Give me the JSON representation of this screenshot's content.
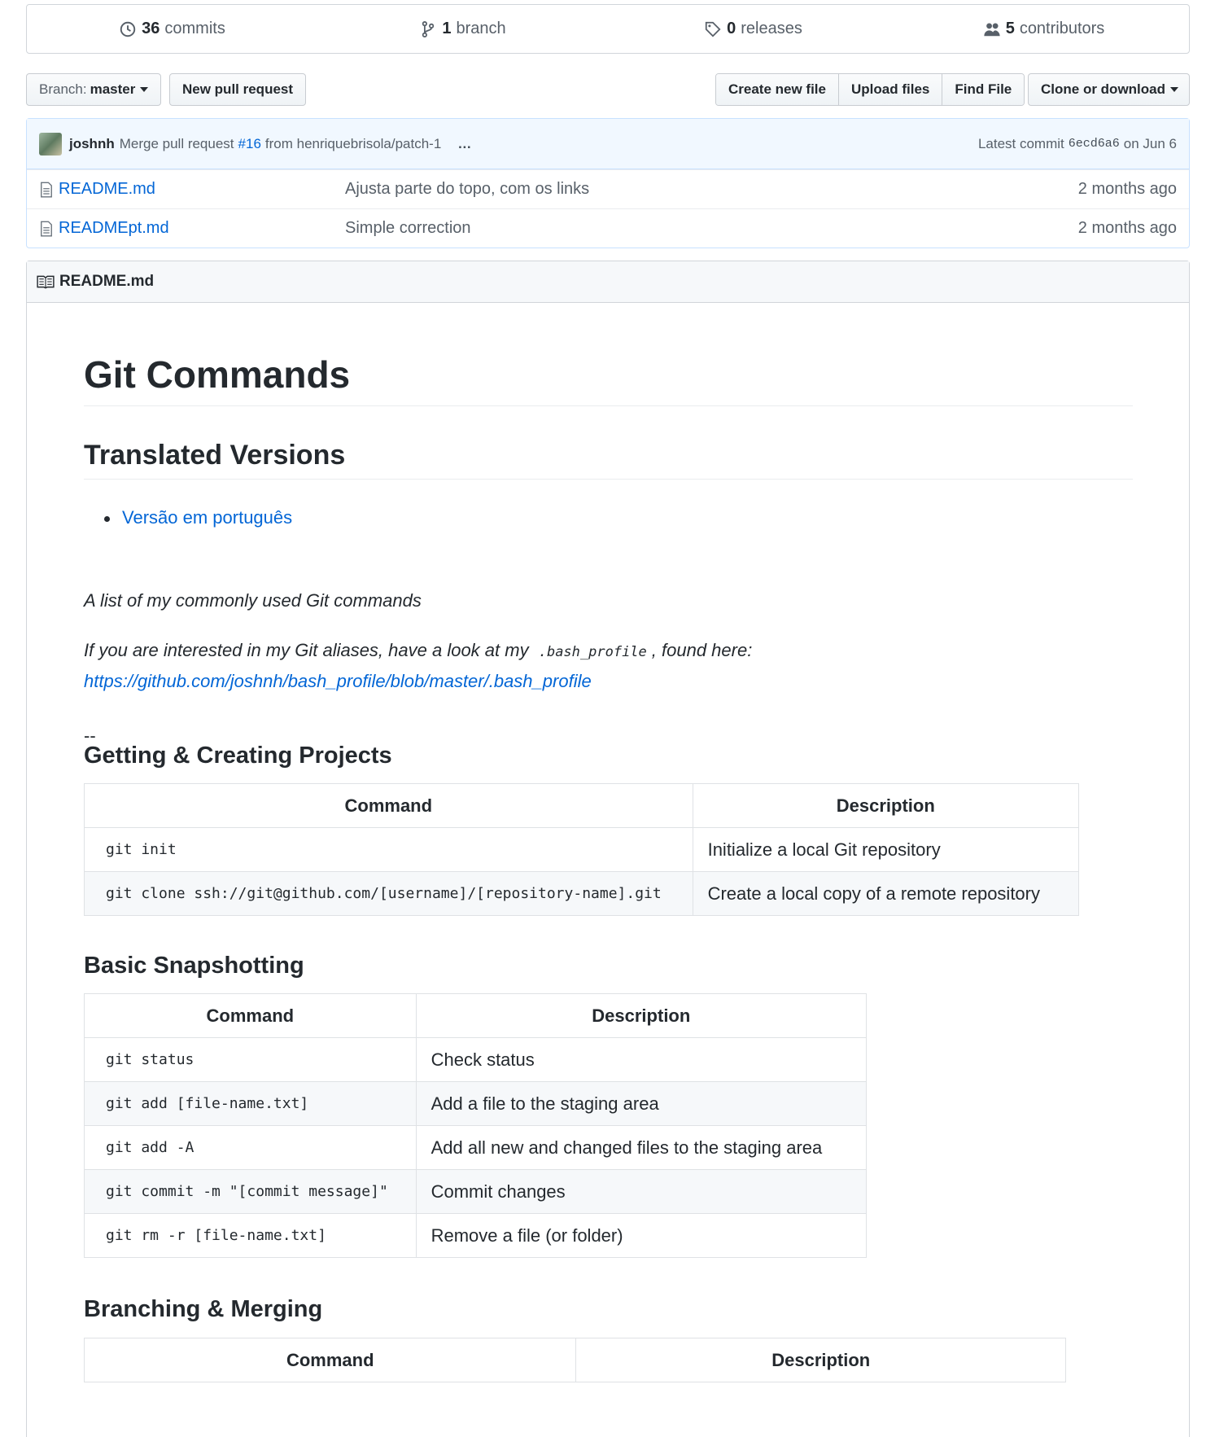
{
  "summary": {
    "commits_count": "36",
    "commits_label": "commits",
    "branch_count": "1",
    "branch_label": "branch",
    "releases_count": "0",
    "releases_label": "releases",
    "contributors_count": "5",
    "contributors_label": "contributors"
  },
  "toolbar": {
    "branch_prefix": "Branch:",
    "branch_name": "master",
    "new_pr": "New pull request",
    "create_file": "Create new file",
    "upload_files": "Upload files",
    "find_file": "Find File",
    "clone": "Clone or download"
  },
  "commit": {
    "author": "joshnh",
    "msg_before": "Merge pull request",
    "pr_link": "#16",
    "msg_after": "from henriquebrisola/patch-1",
    "ellipsis": "…",
    "latest_label": "Latest commit",
    "sha": "6ecd6a6",
    "date": "on Jun 6"
  },
  "files": [
    {
      "name": "README.md",
      "message": "Ajusta parte do topo, com os links",
      "age": "2 months ago"
    },
    {
      "name": "READMEpt.md",
      "message": "Simple correction",
      "age": "2 months ago"
    }
  ],
  "readme": {
    "header": "README.md",
    "title": "Git Commands",
    "translated_heading": "Translated Versions",
    "translated_link": "Versão em português",
    "intro": "A list of my commonly used Git commands",
    "aliases_before": "If you are interested in my Git aliases, have a look at my",
    "aliases_code": ".bash_profile",
    "aliases_after": ", found here:",
    "aliases_link": "https://github.com/joshnh/bash_profile/blob/master/.bash_profile",
    "dash": "--",
    "col_command": "Command",
    "col_description": "Description",
    "sections": [
      {
        "title": "Getting & Creating Projects",
        "rows": [
          {
            "cmd": "git init",
            "desc": "Initialize a local Git repository"
          },
          {
            "cmd": "git clone ssh://git@github.com/[username]/[repository-name].git",
            "desc": "Create a local copy of a remote repository"
          }
        ]
      },
      {
        "title": "Basic Snapshotting",
        "rows": [
          {
            "cmd": "git status",
            "desc": "Check status"
          },
          {
            "cmd": "git add [file-name.txt]",
            "desc": "Add a file to the staging area"
          },
          {
            "cmd": "git add -A",
            "desc": "Add all new and changed files to the staging area"
          },
          {
            "cmd": "git commit -m \"[commit message]\"",
            "desc": "Commit changes"
          },
          {
            "cmd": "git rm -r [file-name.txt]",
            "desc": "Remove a file (or folder)"
          }
        ]
      },
      {
        "title": "Branching & Merging",
        "rows": []
      }
    ]
  }
}
